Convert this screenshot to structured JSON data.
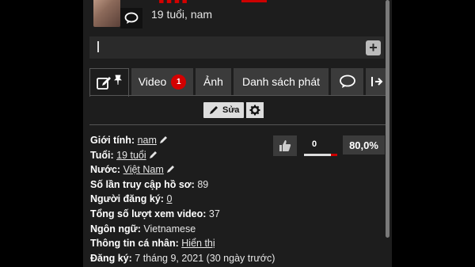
{
  "profile": {
    "age_gender": "19 tuổi, nam"
  },
  "status_input": {
    "value": "",
    "add_label": "+"
  },
  "tabs": [
    {
      "label": ""
    },
    {
      "label": "Video",
      "badge": "1"
    },
    {
      "label": "Ảnh"
    },
    {
      "label": "Danh sách phát"
    },
    {
      "label": ""
    },
    {
      "label": ""
    }
  ],
  "edit": {
    "edit_label": "Sửa"
  },
  "info": {
    "gender_label": "Giới tính:",
    "gender_value": "nam",
    "age_label": "Tuổi:",
    "age_value": "19 tuổi",
    "country_label": "Nước:",
    "country_value": "Việt Nam",
    "visits_label": "Số lần truy cập hồ sơ:",
    "visits_value": "89",
    "subscribers_label": "Người đăng ký:",
    "subscribers_value": "0",
    "views_label": "Tổng số lượt xem video:",
    "views_value": "37",
    "language_label": "Ngôn ngữ:",
    "language_value": "Vietnamese",
    "personal_label": "Thông tin cá nhân:",
    "personal_value": "Hiển thị",
    "joined_label": "Đăng ký:",
    "joined_value": "7 tháng 9, 2021 (30 ngày trước)"
  },
  "votes": {
    "count": "0",
    "rating": "80,0%"
  },
  "colors": {
    "accent_red": "#d40000",
    "panel_bg": "#1d1d1d",
    "tab_bg": "#3b3b3b"
  },
  "icons": [
    "chat-bubble-icon",
    "plus-icon",
    "edit-note-icon",
    "pin-icon",
    "comment-icon",
    "share-icon",
    "pencil-icon",
    "gear-icon",
    "thumbs-up-icon"
  ]
}
